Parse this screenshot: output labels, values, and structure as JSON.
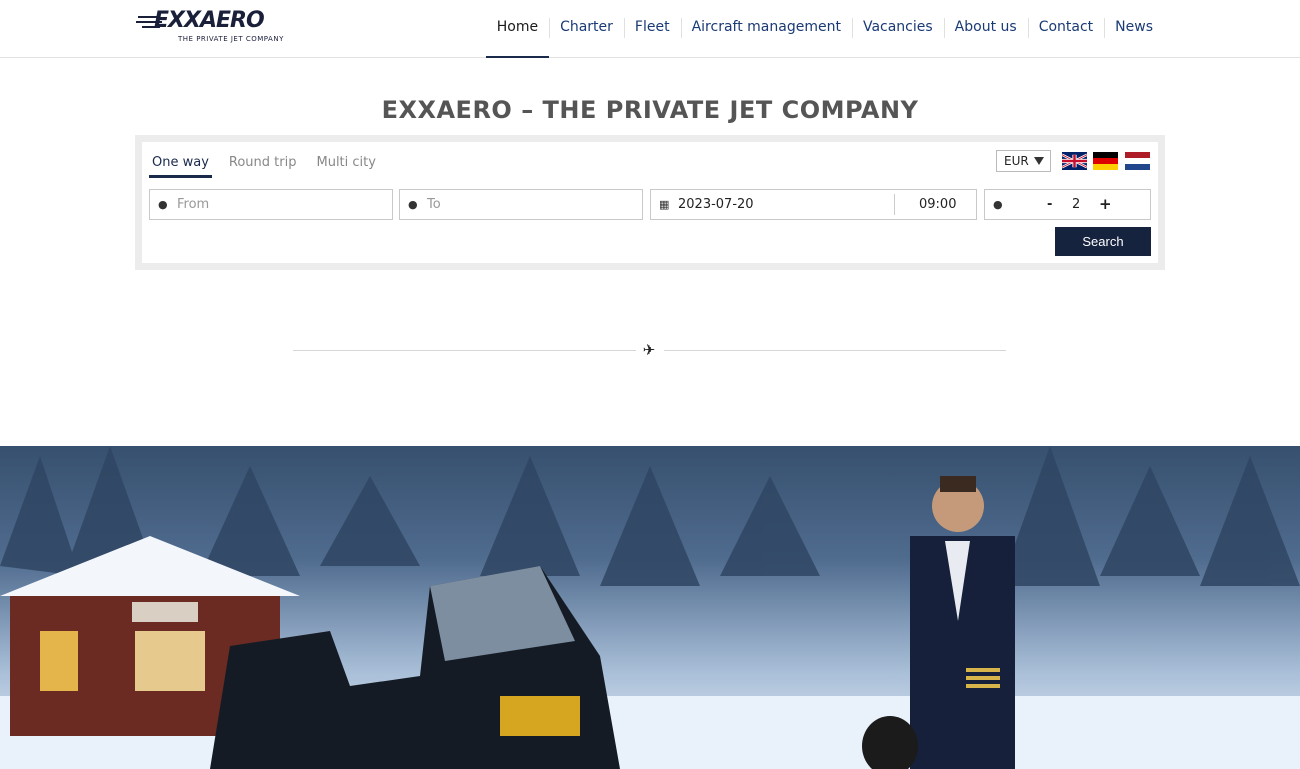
{
  "logo": {
    "text": "EXXAERO",
    "tagline": "THE PRIVATE JET COMPANY"
  },
  "nav": {
    "items": [
      {
        "label": "Home",
        "active": true
      },
      {
        "label": "Charter"
      },
      {
        "label": "Fleet"
      },
      {
        "label": "Aircraft management"
      },
      {
        "label": "Vacancies"
      },
      {
        "label": "About us"
      },
      {
        "label": "Contact"
      },
      {
        "label": "News"
      }
    ]
  },
  "page": {
    "title": "EXXAERO – THE PRIVATE JET COMPANY"
  },
  "booking": {
    "tabs": [
      "One way",
      "Round trip",
      "Multi city"
    ],
    "active_tab": "One way",
    "currency": "EUR",
    "languages": [
      "english-flag-icon",
      "german-flag-icon",
      "dutch-flag-icon"
    ],
    "from_placeholder": "From",
    "to_placeholder": "To",
    "date": "2023-07-20",
    "time": "09:00",
    "passengers": "2",
    "minus": "-",
    "plus": "+",
    "search_label": "Search"
  },
  "colors": {
    "brand_navy": "#15233f",
    "nav_link": "#1a3a75"
  },
  "divider_icon": "plane-icon",
  "hero": {
    "description_icon": "hero-image"
  }
}
